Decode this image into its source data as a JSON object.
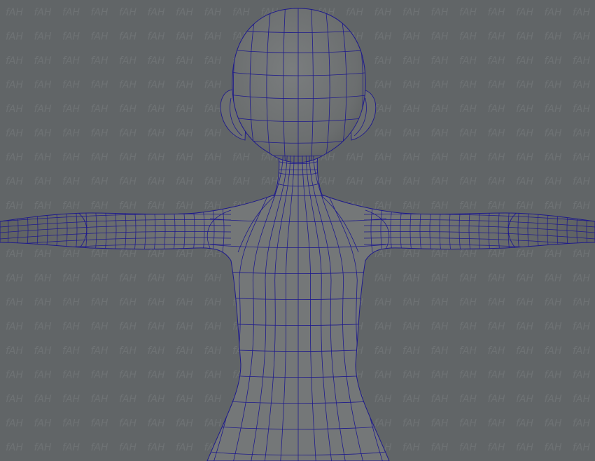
{
  "viewport": {
    "label": "3D modeling viewport",
    "background_color": "#616567",
    "model": {
      "label": "stylized character base mesh, T-pose, back view",
      "display_mode": "smooth shaded with wireframe on shaded",
      "shading_color": "#6f7273",
      "wireframe_color": "#1e1a8c"
    },
    "watermark": {
      "text": "fAH",
      "color": "#7a7e80"
    }
  }
}
